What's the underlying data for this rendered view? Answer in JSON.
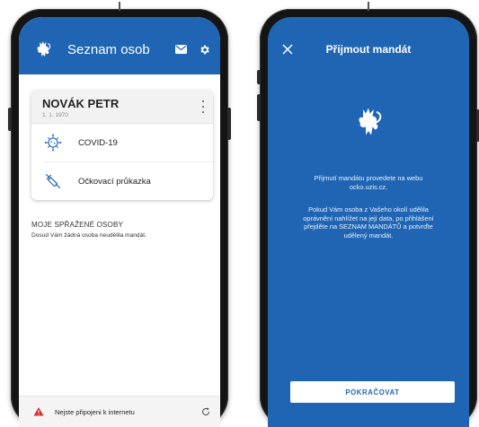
{
  "people_screen": {
    "title": "Seznam osob",
    "icons": {
      "logo": "czech-lion-icon",
      "mail": "mail-icon",
      "settings": "gear-icon"
    },
    "person": {
      "name": "NOVÁK PETR",
      "dob": "1. 1. 1970",
      "items": [
        {
          "label": "COVID-19",
          "icon": "virus-icon"
        },
        {
          "label": "Očkovací průkazka",
          "icon": "syringe-icon"
        }
      ]
    },
    "linked_section": {
      "title": "MOJE SPŘAŽENÉ OSOBY",
      "empty_text": "Dosud Vám žádná osoba neudělila mandát."
    },
    "offline_banner": {
      "text": "Nejste připojeni k internetu",
      "icon": "warning-icon",
      "action_icon": "refresh-icon"
    }
  },
  "mandate_screen": {
    "title": "Přijmout mandát",
    "close_icon": "close-icon",
    "logo_icon": "czech-lion-icon",
    "message_1_line1": "Přijmutí mandátu provedete na webu",
    "message_1_line2": "ocko.uzis.cz.",
    "message_2_line1": "Pokud Vám osoba z Vašeho okolí udělila",
    "message_2_line2": "oprávnění nahlížet na její data, po přihlášení",
    "message_2_line3": "přejděte na SEZNAM MANDÁTŮ a potvrďte",
    "message_2_line4": "udělený mandát.",
    "continue_button": "POKRAČOVAT"
  },
  "colors": {
    "primary_blue": "#1f65b4",
    "warning_red": "#d32f2f"
  }
}
